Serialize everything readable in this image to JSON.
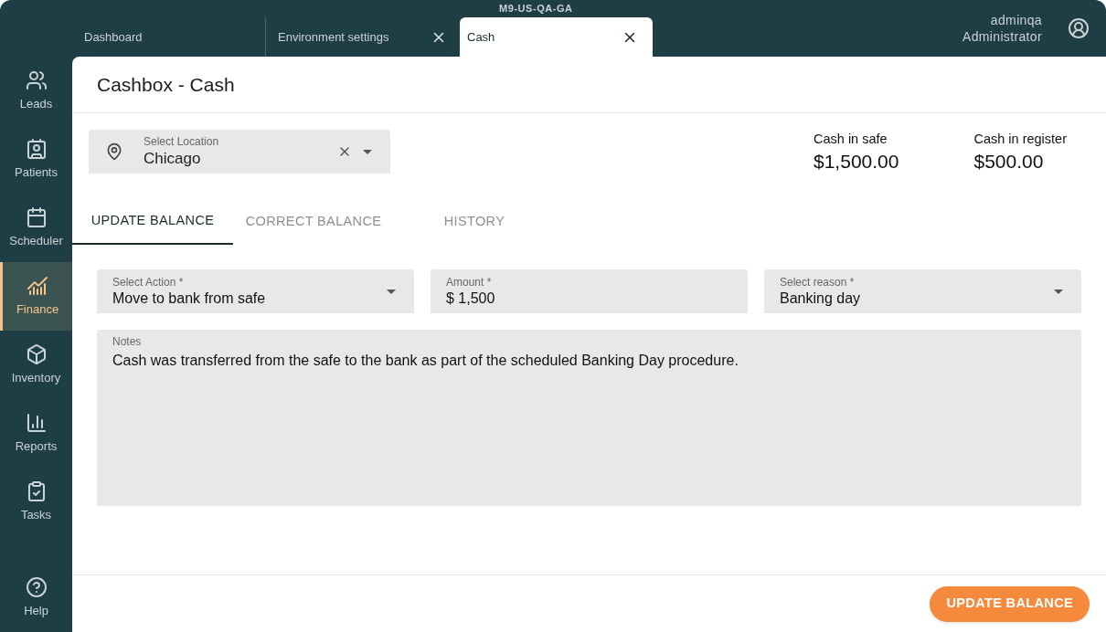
{
  "environment": "M9-US-QA-GA",
  "tabs": [
    {
      "label": "Dashboard",
      "selected": false,
      "closable": false
    },
    {
      "label": "Environment settings",
      "selected": false,
      "closable": true
    },
    {
      "label": "Cash",
      "selected": true,
      "closable": true
    }
  ],
  "user": {
    "name": "adminqa",
    "role": "Administrator"
  },
  "sidebar": {
    "items": [
      {
        "label": "Leads",
        "kind": "users",
        "selected": false
      },
      {
        "label": "Patients",
        "kind": "patient",
        "selected": false
      },
      {
        "label": "Scheduler",
        "kind": "calendar",
        "selected": false
      },
      {
        "label": "Finance",
        "kind": "finance",
        "selected": true
      },
      {
        "label": "Inventory",
        "kind": "box",
        "selected": false
      },
      {
        "label": "Reports",
        "kind": "chart",
        "selected": false
      },
      {
        "label": "Tasks",
        "kind": "tasks",
        "selected": false
      }
    ],
    "help": "Help"
  },
  "page_title": "Cashbox - Cash",
  "location": {
    "label": "Select Location",
    "value": "Chicago"
  },
  "balances": [
    {
      "label": "Cash in safe",
      "value": "$1,500.00"
    },
    {
      "label": "Cash in register",
      "value": "$500.00"
    }
  ],
  "balance_tabs": [
    {
      "label": "UPDATE BALANCE",
      "selected": true
    },
    {
      "label": "CORRECT BALANCE",
      "selected": false
    },
    {
      "label": "HISTORY",
      "selected": false
    }
  ],
  "form": {
    "fields": [
      {
        "kind": "select",
        "label": "Select Action *",
        "value": "Move to bank from safe"
      },
      {
        "kind": "input",
        "label": "Amount *",
        "value": "$ 1,500"
      },
      {
        "kind": "select",
        "label": "Select reason *",
        "value": "Banking day"
      }
    ],
    "notes": {
      "label": "Notes",
      "value": "Cash was transferred from the safe to the bank as part of the scheduled Banking Day procedure."
    }
  },
  "submit": "UPDATE BALANCE"
}
